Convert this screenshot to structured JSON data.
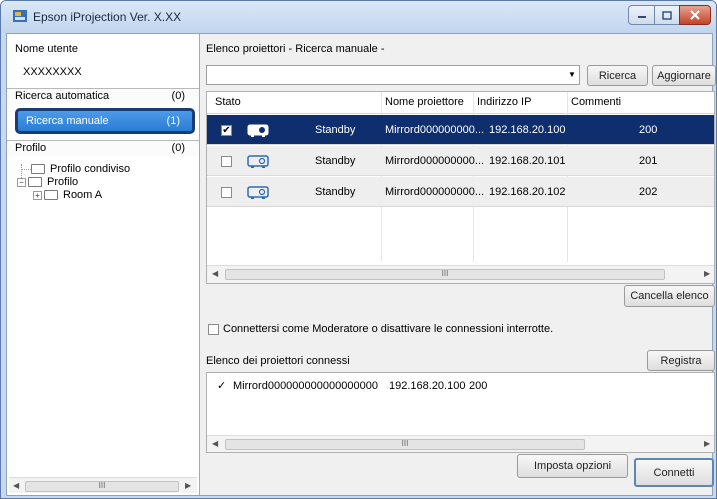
{
  "window": {
    "title": "Epson iProjection Ver. X.XX"
  },
  "sidebar": {
    "user_label": "Nome utente",
    "user_value": "XXXXXXXX",
    "auto_search": {
      "label": "Ricerca automatica",
      "count": "(0)"
    },
    "manual_search": {
      "label": "Ricerca manuale",
      "count": "(1)"
    },
    "profile": {
      "label": "Profilo",
      "count": "(0)"
    },
    "tree": {
      "shared_profile": "Profilo condiviso",
      "profile": "Profilo",
      "room": "Room A"
    },
    "scroll_thumb": "III"
  },
  "main": {
    "list_title": "Elenco proiettori - Ricerca manuale -",
    "combo_value": "",
    "search_button": "Ricerca",
    "refresh_button": "Aggiornare",
    "table": {
      "headers": {
        "status": "Stato",
        "name": "Nome proiettore",
        "ip": "Indirizzo IP",
        "comments": "Commenti"
      },
      "rows": [
        {
          "checked": "✔",
          "status": "Standby",
          "name": "Mirrord000000000...",
          "ip": "192.168.20.100",
          "comment": "200"
        },
        {
          "checked": "",
          "status": "Standby",
          "name": "Mirrord000000000...",
          "ip": "192.168.20.101",
          "comment": "201"
        },
        {
          "checked": "",
          "status": "Standby",
          "name": "Mirrord000000000...",
          "ip": "192.168.20.102",
          "comment": "202"
        }
      ],
      "scroll_thumb": "III"
    },
    "clear_list_button": "Cancella elenco",
    "moderator_label": "Connettersi come Moderatore o disattivare le connessioni interrotte.",
    "connected_title": "Elenco dei proiettori connessi",
    "register_button": "Registra",
    "connected": {
      "check": "✓",
      "name": "Mirrord000000000000000000",
      "ip": "192.168.20.100",
      "comment": "200",
      "scroll_thumb": "III"
    },
    "options_button": "Imposta opzioni",
    "connect_button": "Connetti"
  },
  "colors": {
    "selection": "#0e2e6e",
    "highlight": "#2a7cd6",
    "highlight_border": "#1a3c74"
  }
}
